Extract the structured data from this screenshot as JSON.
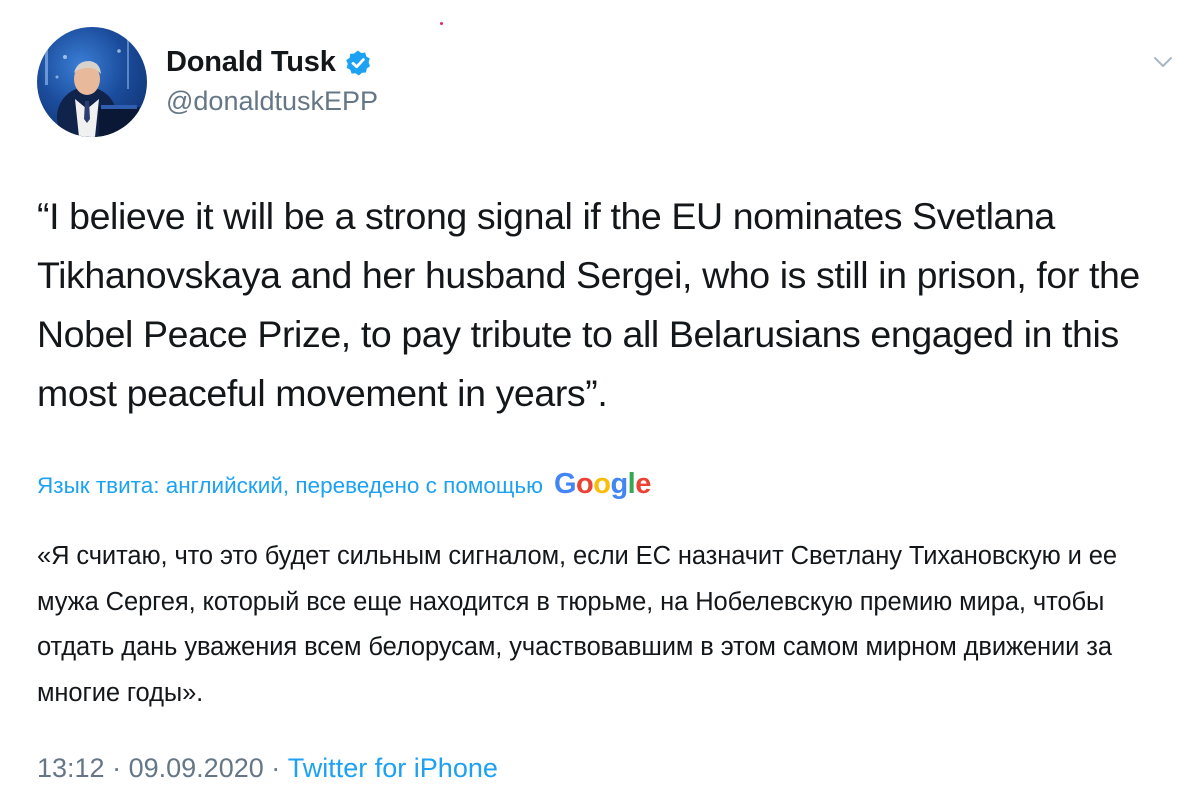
{
  "author": {
    "display_name": "Donald Tusk",
    "handle": "@donaldtuskEPP",
    "verified_icon": "verified-badge-icon",
    "avatar_icon": "avatar-photo"
  },
  "tweet": {
    "text": "“I believe it will be a strong signal if the EU nominates Svetlana Tikhanovskaya and her husband Sergei, who is still in prison, for the Nobel Peace Prize, to pay tribute to all Belarusians engaged in this most peaceful movement in years”.",
    "translation_label": "Язык твита: английский, переведено с помощью",
    "translation_provider": "Google",
    "translated_text": "«Я считаю, что это будет сильным сигналом, если ЕС назначит Светлану Тихановскую и ее мужа Сергея, который все еще находится в тюрьме, на Нобелевскую премию мира, чтобы отдать дань уважения всем белорусам, участвовавшим в этом самом мирном движении за многие годы».",
    "time": "13:12",
    "date": "09.09.2020",
    "separator": "·",
    "source": "Twitter for iPhone"
  },
  "colors": {
    "accent": "#1da1f2",
    "secondary_text": "#657786",
    "primary_text": "#14171a",
    "google_blue": "#4285f4",
    "google_red": "#ea4335",
    "google_yellow": "#fbbc05",
    "google_green": "#34a853"
  }
}
